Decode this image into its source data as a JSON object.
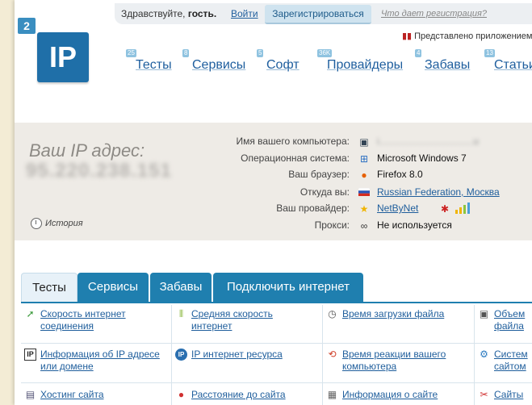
{
  "topbar": {
    "greeting": "Здравствуйте,",
    "guest": "гость.",
    "login": "Войти",
    "register": "Зарегистрироваться",
    "what_gives": "Что дает регистрация?",
    "presented": "Представлено приложением"
  },
  "logo": {
    "small": "2",
    "main": "IP"
  },
  "nav": [
    {
      "label": "Тесты",
      "count": "25"
    },
    {
      "label": "Сервисы",
      "count": "8"
    },
    {
      "label": "Софт",
      "count": "5"
    },
    {
      "label": "Провайдеры",
      "count": "36K"
    },
    {
      "label": "Забавы",
      "count": "4"
    },
    {
      "label": "Статьи",
      "count": "13"
    }
  ],
  "ip": {
    "label": "Ваш IP адрес:",
    "value": "95.220.238.151",
    "history": "История"
  },
  "info": [
    {
      "key": "Имя вашего компьютера:",
      "value": "i...................................u",
      "icon": "computer-icon"
    },
    {
      "key": "Операционная система:",
      "value": "Microsoft Windows 7",
      "icon": "windows-icon"
    },
    {
      "key": "Ваш браузер:",
      "value": "Firefox 8.0",
      "icon": "firefox-icon"
    },
    {
      "key": "Откуда вы:",
      "value": "Russian Federation, Москва",
      "icon": "flag-icon"
    },
    {
      "key": "Ваш провайдер:",
      "value": "NetByNet",
      "icon": "star-icon"
    },
    {
      "key": "Прокси:",
      "value": "Не используется",
      "icon": "glasses-icon"
    }
  ],
  "tabs": [
    "Тесты",
    "Сервисы",
    "Забавы",
    "Подключить интернет"
  ],
  "grid": [
    [
      "Скорость интернет",
      "соединения"
    ],
    [
      "Средняя скорость",
      "интернет"
    ],
    [
      "Время загрузки файла",
      ""
    ],
    [
      "Объем",
      "файла"
    ],
    [
      "Информация об IP адресе",
      "или домене"
    ],
    [
      "IP интернет ресурса",
      ""
    ],
    [
      "Время реакции вашего",
      "компьютера"
    ],
    [
      "Систем",
      "сайтом"
    ],
    [
      "Хостинг сайта",
      ""
    ],
    [
      "Расстояние до сайта",
      ""
    ],
    [
      "Информация о сайте",
      ""
    ],
    [
      "Сайты",
      ""
    ]
  ],
  "colors": {
    "accent": "#1f7faf",
    "link": "#1f5e9c",
    "logo": "#1f6fa8"
  }
}
